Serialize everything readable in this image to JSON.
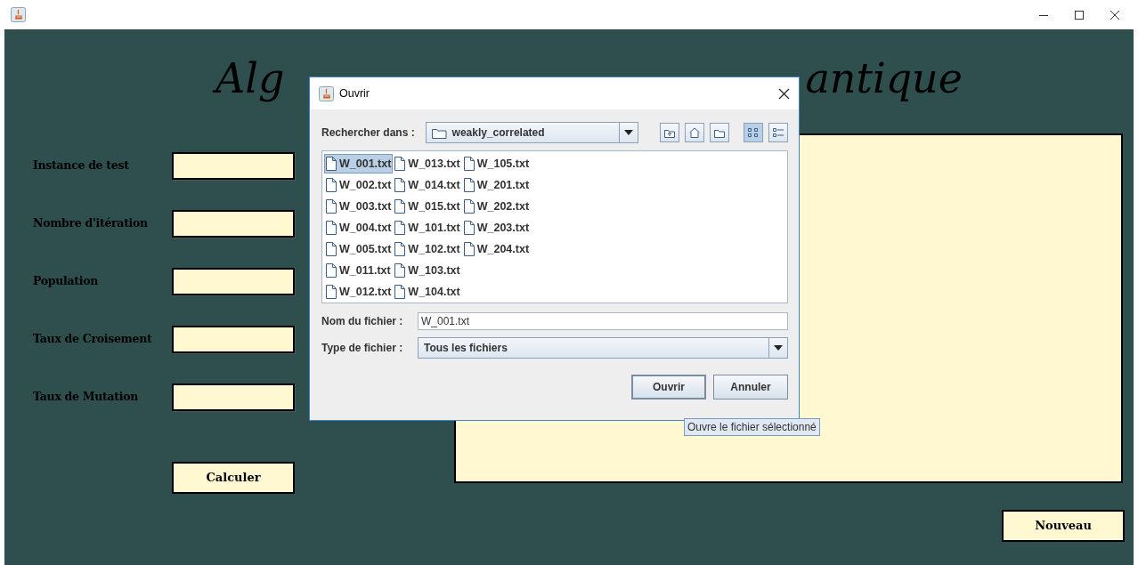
{
  "heading_parts": [
    "Alg",
    "antique"
  ],
  "form": {
    "fields": [
      {
        "label": "Instance de test"
      },
      {
        "label": "Nombre d'itération"
      },
      {
        "label": "Population"
      },
      {
        "label": "Taux de Croisement"
      },
      {
        "label": "Taux de Mutation"
      }
    ],
    "calculate_button": "Calculer"
  },
  "new_button": "Nouveau",
  "dialog": {
    "title": "Ouvrir",
    "look_in_label": "Rechercher dans :",
    "look_in_value": "weakly_correlated",
    "toolbar": [
      {
        "kind": "up",
        "selected": false
      },
      {
        "kind": "home",
        "selected": false
      },
      {
        "kind": "new-folder",
        "selected": false
      },
      {
        "kind": "list",
        "selected": true
      },
      {
        "kind": "details",
        "selected": false
      }
    ],
    "files": [
      {
        "name": "W_001.txt",
        "selected": true
      },
      {
        "name": "W_002.txt",
        "selected": false
      },
      {
        "name": "W_003.txt",
        "selected": false
      },
      {
        "name": "W_004.txt",
        "selected": false
      },
      {
        "name": "W_005.txt",
        "selected": false
      },
      {
        "name": "W_011.txt",
        "selected": false
      },
      {
        "name": "W_012.txt",
        "selected": false
      },
      {
        "name": "W_013.txt",
        "selected": false
      },
      {
        "name": "W_014.txt",
        "selected": false
      },
      {
        "name": "W_015.txt",
        "selected": false
      },
      {
        "name": "W_101.txt",
        "selected": false
      },
      {
        "name": "W_102.txt",
        "selected": false
      },
      {
        "name": "W_103.txt",
        "selected": false
      },
      {
        "name": "W_104.txt",
        "selected": false
      },
      {
        "name": "W_105.txt",
        "selected": false
      },
      {
        "name": "W_201.txt",
        "selected": false
      },
      {
        "name": "W_202.txt",
        "selected": false
      },
      {
        "name": "W_203.txt",
        "selected": false
      },
      {
        "name": "W_204.txt",
        "selected": false
      }
    ],
    "file_name_label": "Nom du fichier :",
    "file_name_value": "W_001.txt",
    "file_type_label": "Type de fichier :",
    "file_type_value": "Tous les fichiers",
    "buttons": [
      "Ouvrir",
      "Annuler"
    ],
    "tooltip": "Ouvre le fichier sélectionné"
  }
}
